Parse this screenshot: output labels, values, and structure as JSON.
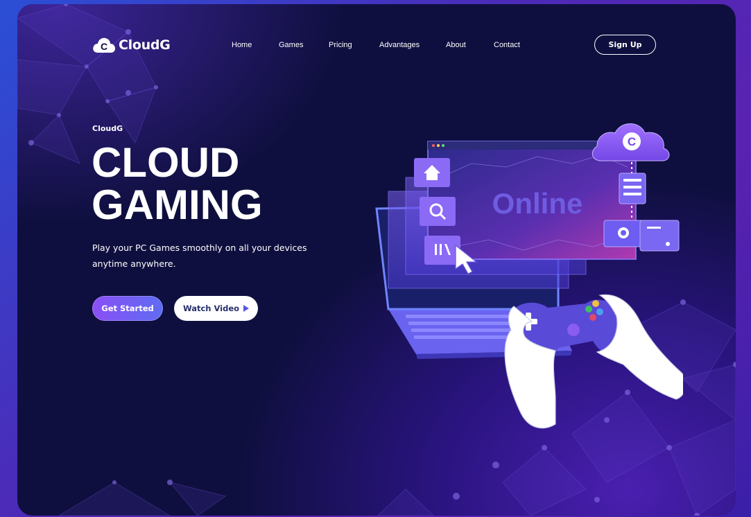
{
  "brand": {
    "name": "CloudG",
    "logo_letter": "C"
  },
  "nav": {
    "items": [
      {
        "label": "Home"
      },
      {
        "label": "Games"
      },
      {
        "label": "Pricing"
      },
      {
        "label": "Advantages"
      },
      {
        "label": "About"
      },
      {
        "label": "Contact"
      }
    ],
    "signup_label": "Sign Up"
  },
  "hero": {
    "eyebrow": "CloudG",
    "title_line1": "CLOUD",
    "title_line2": "GAMING",
    "description_line1": "Play your PC Games smoothly on all your devices",
    "description_line2": "anytime anywhere.",
    "primary_button": "Get Started",
    "secondary_button": "Watch Video"
  },
  "illustration": {
    "screen_text": "Online",
    "cloud_letter": "C",
    "icons": [
      "home-icon",
      "search-icon",
      "library-icon",
      "cursor-icon",
      "server-icon",
      "cloud-icon",
      "gamepad-icon"
    ]
  },
  "colors": {
    "background": "#0f0f3f",
    "accent_purple": "#8a4ff5",
    "accent_blue": "#5f6cf2"
  }
}
